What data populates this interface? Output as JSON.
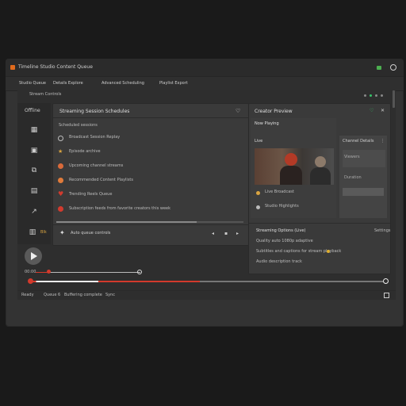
{
  "titlebar": {
    "app_title": "Timeline Studio Content Queue"
  },
  "menubar": {
    "items": [
      "Studio Queue",
      "Details Explore",
      "Advanced Scheduling",
      "Playlist Export"
    ]
  },
  "toolbar": {
    "label": "Stream Controls"
  },
  "sidebar": {
    "items": [
      {
        "label": "Offline",
        "icon": "library-icon"
      },
      {
        "label": "",
        "icon": "grid-icon"
      },
      {
        "label": "",
        "icon": "frame-icon"
      },
      {
        "label": "",
        "icon": "split-icon"
      },
      {
        "label": "",
        "icon": "film-icon"
      },
      {
        "label": "",
        "icon": "trend-icon"
      },
      {
        "label": "Blk",
        "icon": "channel-icon"
      }
    ]
  },
  "queue": {
    "header": "Streaming Session Schedules",
    "section_label": "Scheduled sessions",
    "items": [
      {
        "label": "Broadcast Session Replay",
        "icon": "clock-icon",
        "color": "#bdbdbd"
      },
      {
        "label": "Episode archive",
        "icon": "star-icon",
        "color": "#d9a441"
      },
      {
        "label": "Upcoming channel streams",
        "icon": "fire-icon",
        "color": "#d96a3a"
      },
      {
        "label": "Recommended Content Playlists",
        "icon": "play-circle-icon",
        "color": "#e07b3b"
      },
      {
        "label": "Trending Reels Queue",
        "icon": "heart-icon",
        "color": "#d23b2e"
      },
      {
        "label": "Subscription feeds from favorite creators this week",
        "icon": "record-icon",
        "color": "#d23b2e"
      }
    ],
    "footer_label": "Auto queue controls",
    "progress": 0.75
  },
  "preview": {
    "header": "Creator Preview",
    "thumb_title": "Now Playing",
    "caption1": "Live Broadcast",
    "caption2": "Studio Highlights",
    "side_title": "Channel Details",
    "side_items": [
      "Viewers",
      "Duration"
    ],
    "badge_color": "#35c46a"
  },
  "details": {
    "title": "Streaming Options (Live)",
    "link": "Settings",
    "lines": [
      "Quality auto 1080p adaptive",
      "Subtitles and captions for stream playback",
      "Audio description track"
    ]
  },
  "player": {
    "current_time": "00:00",
    "mini_progress": 0.12,
    "progress": 0.48,
    "accent": "#d33a2c"
  },
  "statusbar": {
    "items": [
      "Ready",
      "Queue 6",
      "Buffering complete",
      "Sync"
    ]
  }
}
